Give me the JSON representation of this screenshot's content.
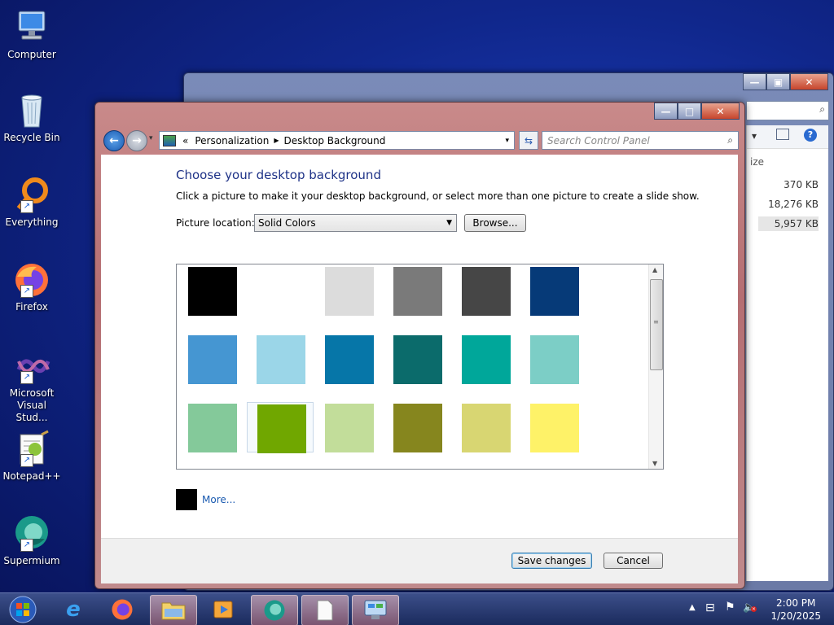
{
  "desktop_icons": [
    {
      "label": "Computer"
    },
    {
      "label": "Recycle Bin"
    },
    {
      "label": "Everything"
    },
    {
      "label": "Firefox"
    },
    {
      "label_line1": "Microsoft",
      "label_line2": "Visual Stud..."
    },
    {
      "label": "Notepad++"
    },
    {
      "label": "Supermium"
    }
  ],
  "background_window": {
    "sizes": [
      "370 KB",
      "18,276 KB",
      "5,957 KB"
    ],
    "column_header": "ize"
  },
  "window": {
    "breadcrumb": {
      "prefix": "«",
      "item1": "Personalization",
      "item2": "Desktop Background"
    },
    "search_placeholder": "Search Control Panel",
    "caption": {
      "minimize": "—",
      "maximize": "□",
      "close": "✕"
    }
  },
  "content": {
    "heading": "Choose your desktop background",
    "description": "Click a picture to make it your desktop background, or select more than one picture to create a slide show.",
    "picture_location_label": "Picture location:",
    "picture_location_value": "Solid Colors",
    "browse_label": "Browse...",
    "more_label": "More...",
    "more_color": "#000000",
    "swatches": [
      [
        "#000000",
        "#ffffff",
        "#dcdcdc",
        "#7a7a7a",
        "#464646",
        "#063a78"
      ],
      [
        "#4596d2",
        "#9bd6e8",
        "#0676a8",
        "#0b6b6b",
        "#00a79a",
        "#7ccec6"
      ],
      [
        "#84c99a",
        "#70a700",
        "#c2dd9a",
        "#86861e",
        "#d8d672",
        "#fef268"
      ]
    ],
    "selected_swatch": "#70a700"
  },
  "footer": {
    "save_label": "Save changes",
    "cancel_label": "Cancel"
  },
  "taskbar": {
    "time": "2:00 PM",
    "date": "1/20/2025"
  }
}
